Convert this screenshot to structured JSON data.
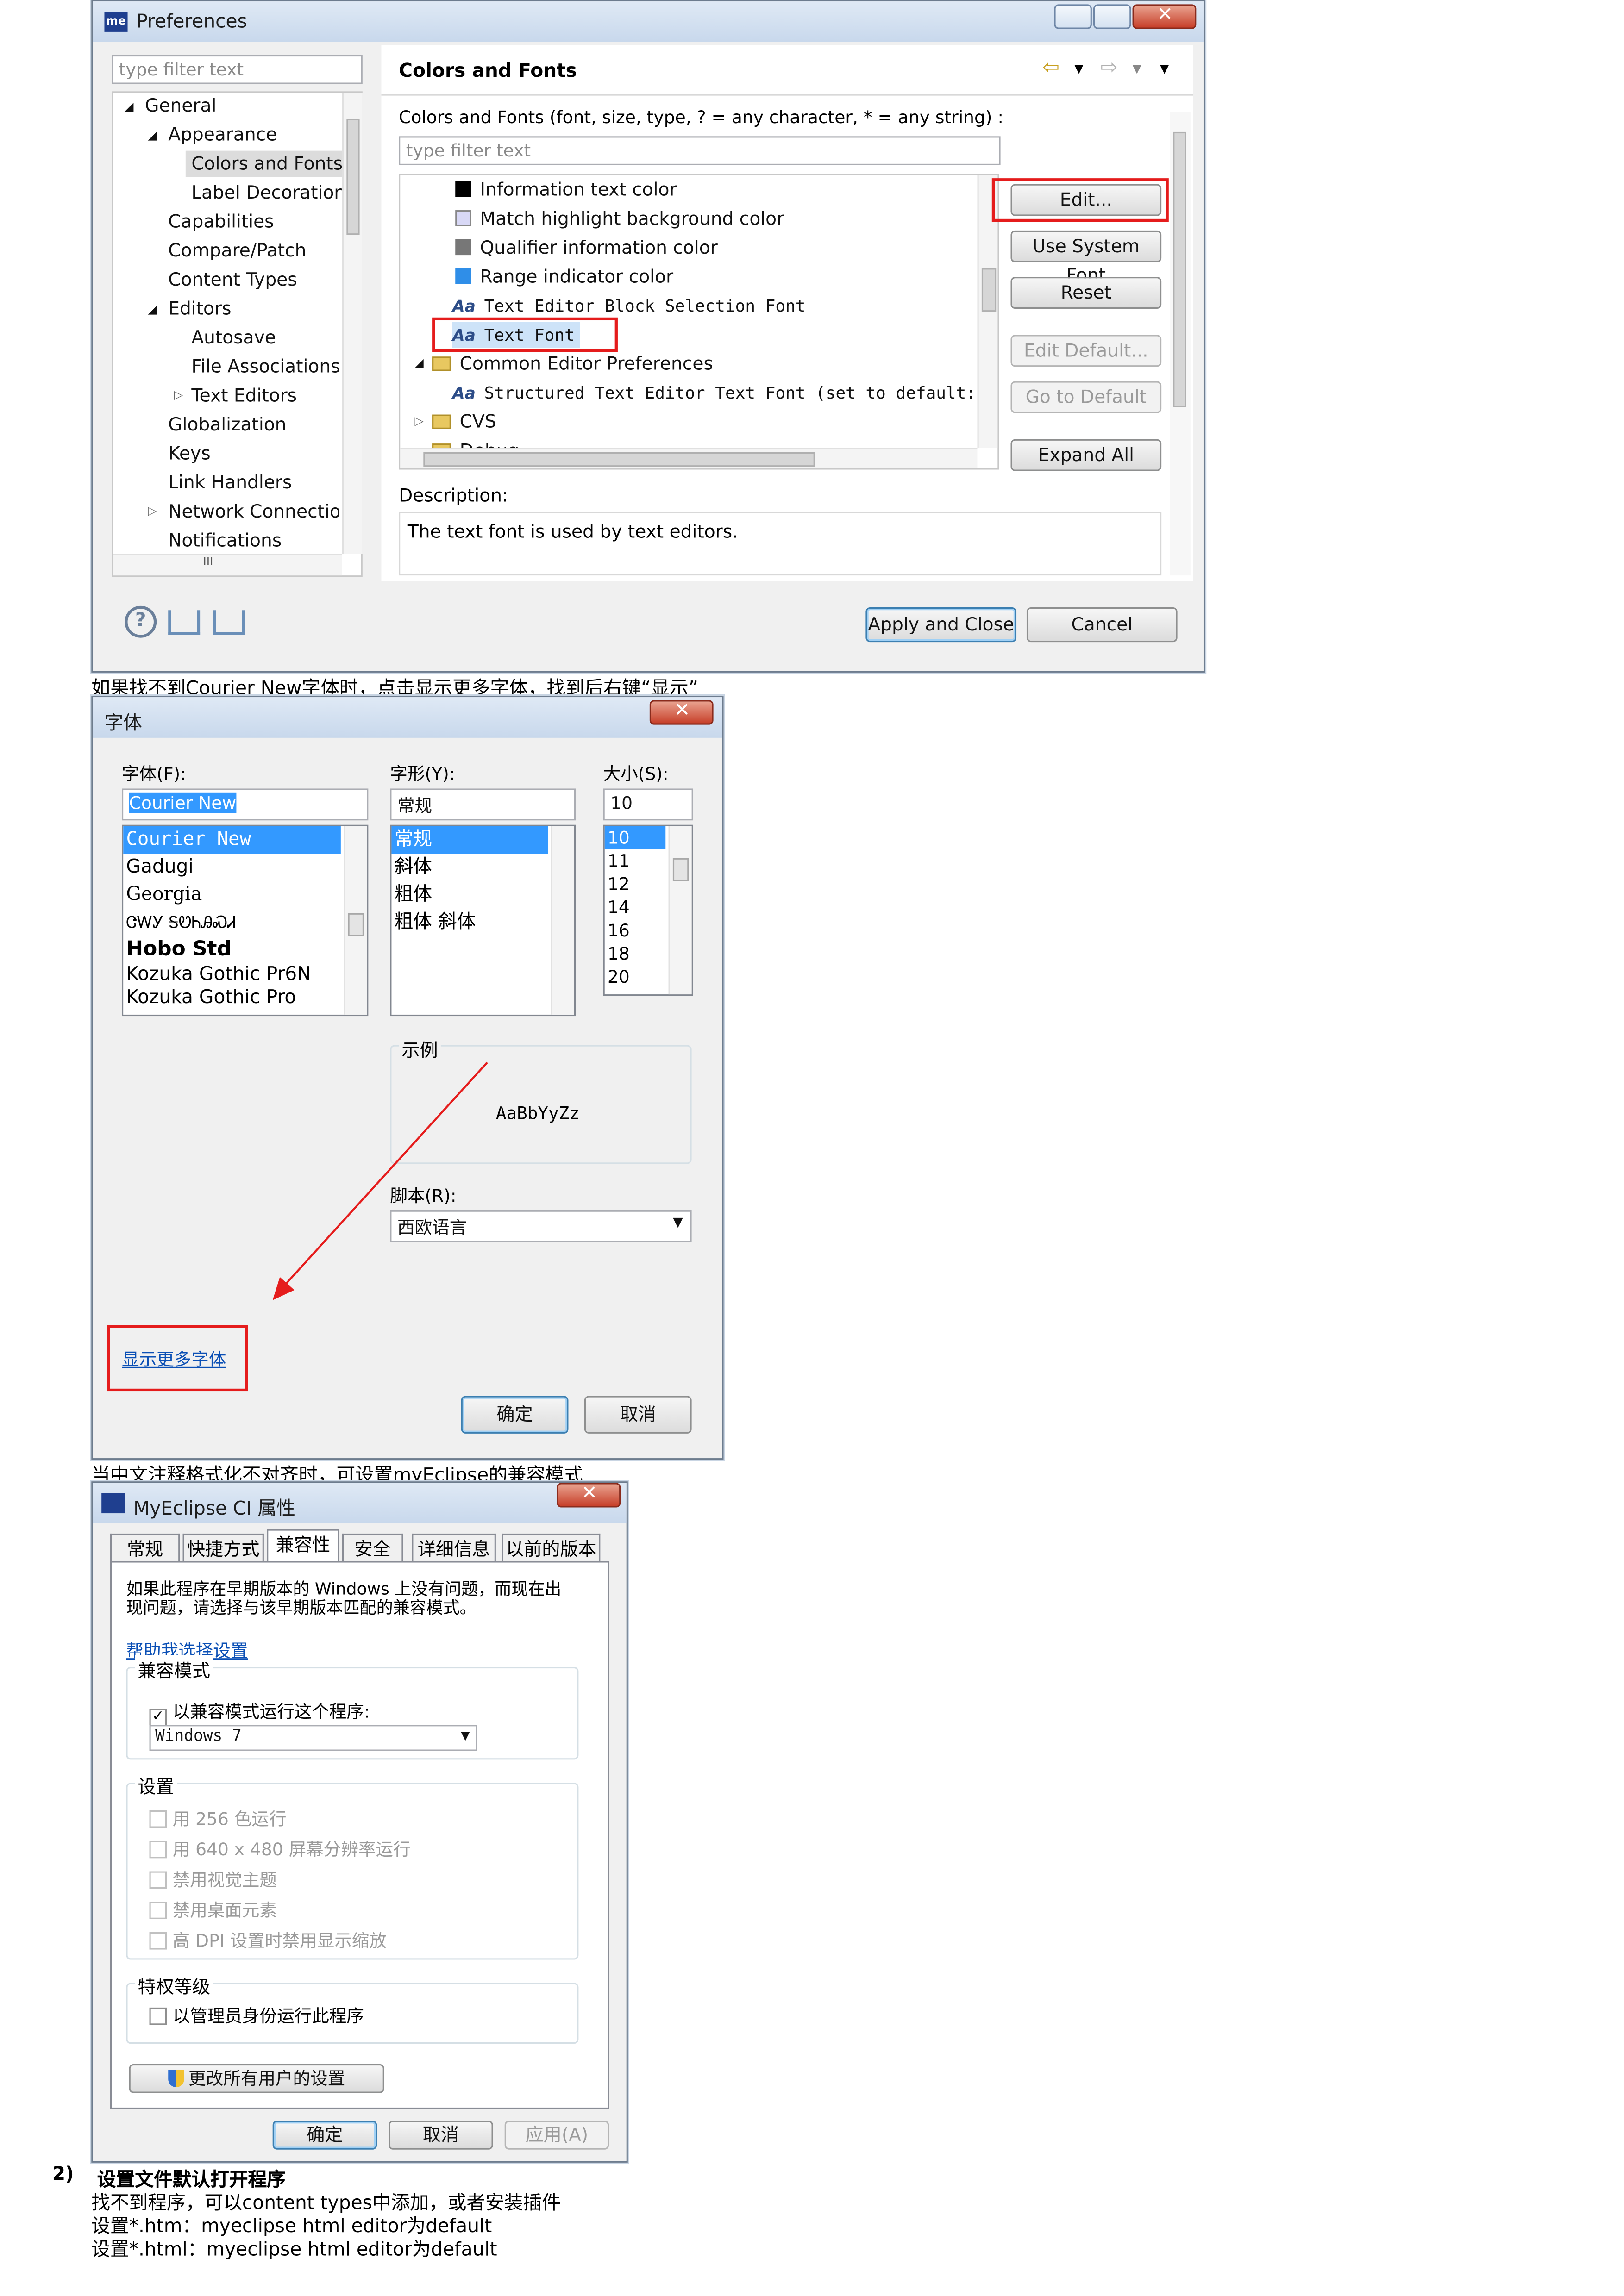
{
  "prefs": {
    "title": "Preferences",
    "logo": "me",
    "filter_placeholder": "type filter text",
    "tree": {
      "general": "General",
      "appearance": "Appearance",
      "colors_fonts": "Colors and Fonts",
      "label_decorations": "Label Decorations",
      "capabilities": "Capabilities",
      "compare_patch": "Compare/Patch",
      "content_types": "Content Types",
      "editors": "Editors",
      "autosave": "Autosave",
      "file_assoc": "File Associations",
      "text_editors": "Text Editors",
      "globalization": "Globalization",
      "keys": "Keys",
      "link_handlers": "Link Handlers",
      "network": "Network Connections",
      "notifications": "Notifications"
    },
    "page_title": "Colors and Fonts",
    "page_desc": "Colors and Fonts (font, size, type, ? = any character, * = any string) :",
    "inner_filter_placeholder": "type filter text",
    "items": {
      "info_text_color": "Information text color",
      "match_hl_bg": "Match highlight background color",
      "qualifier_info": "Qualifier information color",
      "range_indicator": "Range indicator color",
      "block_sel_font": "Text Editor Block Selection Font",
      "text_font": "Text Font",
      "common_editor": "Common Editor Preferences",
      "structured_font": "Structured Text Editor Text Font (set to default:",
      "cvs": "CVS",
      "debug": "Debug"
    },
    "buttons": {
      "edit": "Edit...",
      "use_system_font": "Use System Font",
      "reset": "Reset",
      "edit_default": "Edit Default...",
      "go_default": "Go to Default",
      "expand_all": "Expand All",
      "apply_close": "Apply and Close",
      "cancel": "Cancel"
    },
    "desc_label": "Description:",
    "desc_text": "The text font is used by text editors.",
    "hscroll_mark": "III"
  },
  "caption1": "如果找不到Courier New字体时，点击显示更多字体，找到后右键“显示”",
  "font_dialog": {
    "title": "字体",
    "font_label": "字体(F):",
    "style_label": "字形(Y):",
    "size_label": "大小(S):",
    "font_value": "Courier New",
    "style_value": "常规",
    "size_value": "10",
    "fonts": [
      "Courier New",
      "Gadugi",
      "Georgia",
      "ᏣᎳᎩ ᎦᏬᏂᎯᏍᏗ",
      "Hobo Std",
      "Kozuka Gothic Pr6N",
      "Kozuka Gothic Pro"
    ],
    "styles": [
      "常规",
      "斜体",
      "粗体",
      "粗体 斜体"
    ],
    "sizes": [
      "10",
      "11",
      "12",
      "14",
      "16",
      "18",
      "20"
    ],
    "sample_label": "示例",
    "sample_text": "AaBbYyZz",
    "script_label": "脚本(R):",
    "script_value": "西欧语言",
    "more_fonts": "显示更多字体",
    "ok": "确定",
    "cancel": "取消"
  },
  "caption2": "当中文注释格式化不对齐时，可设置myEclipse的兼容模式",
  "props_dialog": {
    "title": "MyEclipse CI 属性",
    "tabs": [
      "常规",
      "快捷方式",
      "兼容性",
      "安全",
      "详细信息",
      "以前的版本"
    ],
    "intro": [
      "如果此程序在早期版本的 Windows 上没有问题，而现在出",
      "现问题，请选择与该早期版本匹配的兼容模式。"
    ],
    "help_link": "帮助我选择设置",
    "compat_group": "兼容模式",
    "compat_check": "以兼容模式运行这个程序:",
    "compat_value": "Windows 7",
    "settings_group": "设置",
    "settings": [
      "用 256 色运行",
      "用 640 x 480 屏幕分辨率运行",
      "禁用视觉主题",
      "禁用桌面元素",
      "高 DPI 设置时禁用显示缩放"
    ],
    "priv_group": "特权等级",
    "admin_check": "以管理员身份运行此程序",
    "change_all": "更改所有用户的设置",
    "ok": "确定",
    "cancel": "取消",
    "apply": "应用(A)"
  },
  "section": {
    "number": "2)",
    "heading": "设置文件默认打开程序",
    "lines": [
      "找不到程序，可以content types中添加，或者安装插件",
      "设置*.htm：myeclipse html editor为default",
      "设置*.html：myeclipse html editor为default"
    ]
  }
}
